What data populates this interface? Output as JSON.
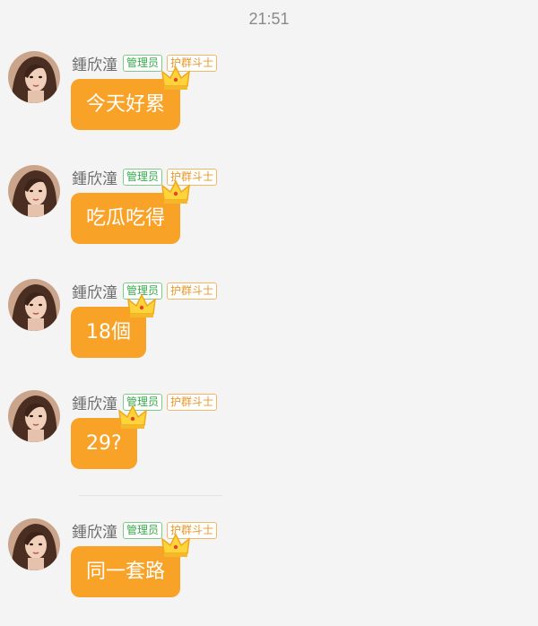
{
  "status": {
    "time": "21:51"
  },
  "messages": [
    {
      "sender": "鍾欣潼",
      "badge_admin": "管理员",
      "badge_fighter": "护群斗士",
      "text": "今天好累"
    },
    {
      "sender": "鍾欣潼",
      "badge_admin": "管理员",
      "badge_fighter": "护群斗士",
      "text": "吃瓜吃得"
    },
    {
      "sender": "鍾欣潼",
      "badge_admin": "管理员",
      "badge_fighter": "护群斗士",
      "text": "18個"
    },
    {
      "sender": "鍾欣潼",
      "badge_admin": "管理员",
      "badge_fighter": "护群斗士",
      "text": "29?"
    },
    {
      "sender": "鍾欣潼",
      "badge_admin": "管理员",
      "badge_fighter": "护群斗士",
      "text": "同一套路"
    }
  ],
  "colors": {
    "bubble": "#f8a227",
    "admin_badge": "#37a94a",
    "fighter_badge": "#e8972b",
    "background": "#f4f4f4"
  },
  "icons": {
    "crown": "crown-icon",
    "avatar": "avatar-image"
  }
}
